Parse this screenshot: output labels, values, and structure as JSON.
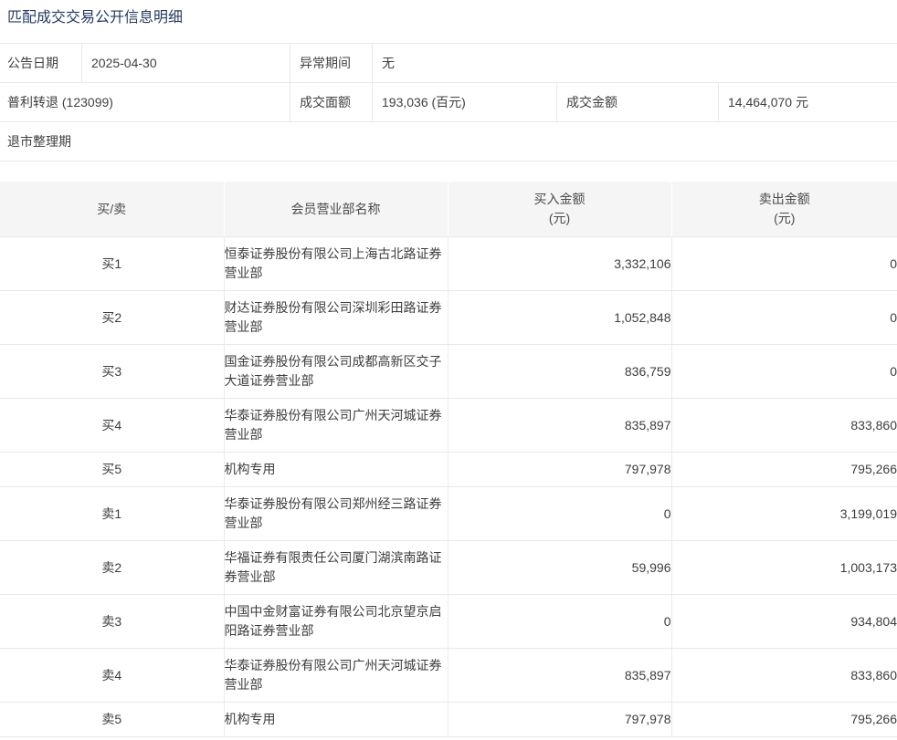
{
  "page": {
    "title": "匹配成交交易公开信息明细"
  },
  "info": {
    "announce_date_label": "公告日期",
    "announce_date_value": "2025-04-30",
    "abnormal_period_label": "异常期间",
    "abnormal_period_value": "无",
    "security_name": "普利转退 (123099)",
    "face_amount_label": "成交面额",
    "face_amount_value": "193,036  (百元)",
    "turnover_label": "成交金额",
    "turnover_value": "14,464,070 元",
    "period_status": "退市整理期"
  },
  "table": {
    "headers": {
      "side": "买/卖",
      "branch": "会员营业部名称",
      "buy": "买入金额\n(元)",
      "sell": "卖出金额\n(元)"
    },
    "rows": [
      {
        "side": "买1",
        "branch": "恒泰证券股份有限公司上海古北路证券\n营业部",
        "buy": "3,332,106",
        "sell": "0"
      },
      {
        "side": "买2",
        "branch": "财达证券股份有限公司深圳彩田路证券\n营业部",
        "buy": "1,052,848",
        "sell": "0"
      },
      {
        "side": "买3",
        "branch": "国金证券股份有限公司成都高新区交子\n大道证券营业部",
        "buy": "836,759",
        "sell": "0"
      },
      {
        "side": "买4",
        "branch": "华泰证券股份有限公司广州天河城证券\n营业部",
        "buy": "835,897",
        "sell": "833,860"
      },
      {
        "side": "买5",
        "branch": "机构专用",
        "buy": "797,978",
        "sell": "795,266"
      },
      {
        "side": "卖1",
        "branch": "华泰证券股份有限公司郑州经三路证券\n营业部",
        "buy": "0",
        "sell": "3,199,019"
      },
      {
        "side": "卖2",
        "branch": "华福证券有限责任公司厦门湖滨南路证\n券营业部",
        "buy": "59,996",
        "sell": "1,003,173"
      },
      {
        "side": "卖3",
        "branch": "中国中金财富证券有限公司北京望京启\n阳路证券营业部",
        "buy": "0",
        "sell": "934,804"
      },
      {
        "side": "卖4",
        "branch": "华泰证券股份有限公司广州天河城证券\n营业部",
        "buy": "835,897",
        "sell": "833,860"
      },
      {
        "side": "卖5",
        "branch": "机构专用",
        "buy": "797,978",
        "sell": "795,266"
      }
    ]
  },
  "colors": {
    "title": "#243b62",
    "header_bg": "#f5f5f6",
    "border": "#e8e8e8"
  }
}
